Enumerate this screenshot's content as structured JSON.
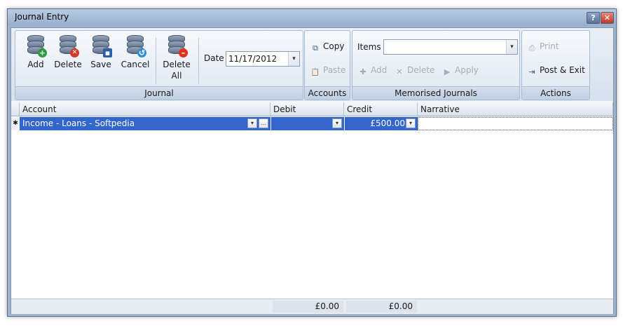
{
  "window": {
    "title": "Journal Entry",
    "help_label": "?",
    "close_label": "✕"
  },
  "ribbon": {
    "journal": {
      "label": "Journal",
      "add": "Add",
      "delete": "Delete",
      "save": "Save",
      "cancel": "Cancel",
      "delete_all_line1": "Delete",
      "delete_all_line2": "All",
      "date_label": "Date",
      "date_value": "11/17/2012"
    },
    "accounts": {
      "label": "Accounts",
      "copy": "Copy",
      "paste": "Paste"
    },
    "memorised": {
      "label": "Memorised Journals",
      "items_label": "Items",
      "items_value": "",
      "add": "Add",
      "delete": "Delete",
      "apply": "Apply"
    },
    "actions": {
      "label": "Actions",
      "print": "Print",
      "post_exit": "Post & Exit"
    }
  },
  "grid": {
    "columns": {
      "account": "Account",
      "debit": "Debit",
      "credit": "Credit",
      "narrative": "Narrative"
    },
    "rows": [
      {
        "marker": "✱",
        "account": "Income - Loans - Softpedia",
        "debit": "",
        "credit": "£500.00",
        "narrative": ""
      }
    ]
  },
  "totals": {
    "debit": "£0.00",
    "credit": "£0.00"
  },
  "icons": {
    "dropdown": "▾",
    "ellipsis": "…",
    "copy": "⧉",
    "paste": "📋",
    "add": "✚",
    "delete": "✕",
    "apply": "▶",
    "print": "⎙",
    "post_exit": "⇥",
    "plus_badge": "+",
    "x_badge": "✕",
    "save_badge": "▪",
    "cancel_badge": "↺",
    "minus_badge": "–"
  },
  "colors": {
    "selection": "#3366cc",
    "ribbon": "#dde7f2",
    "title_bar": "#a9bfdb"
  }
}
